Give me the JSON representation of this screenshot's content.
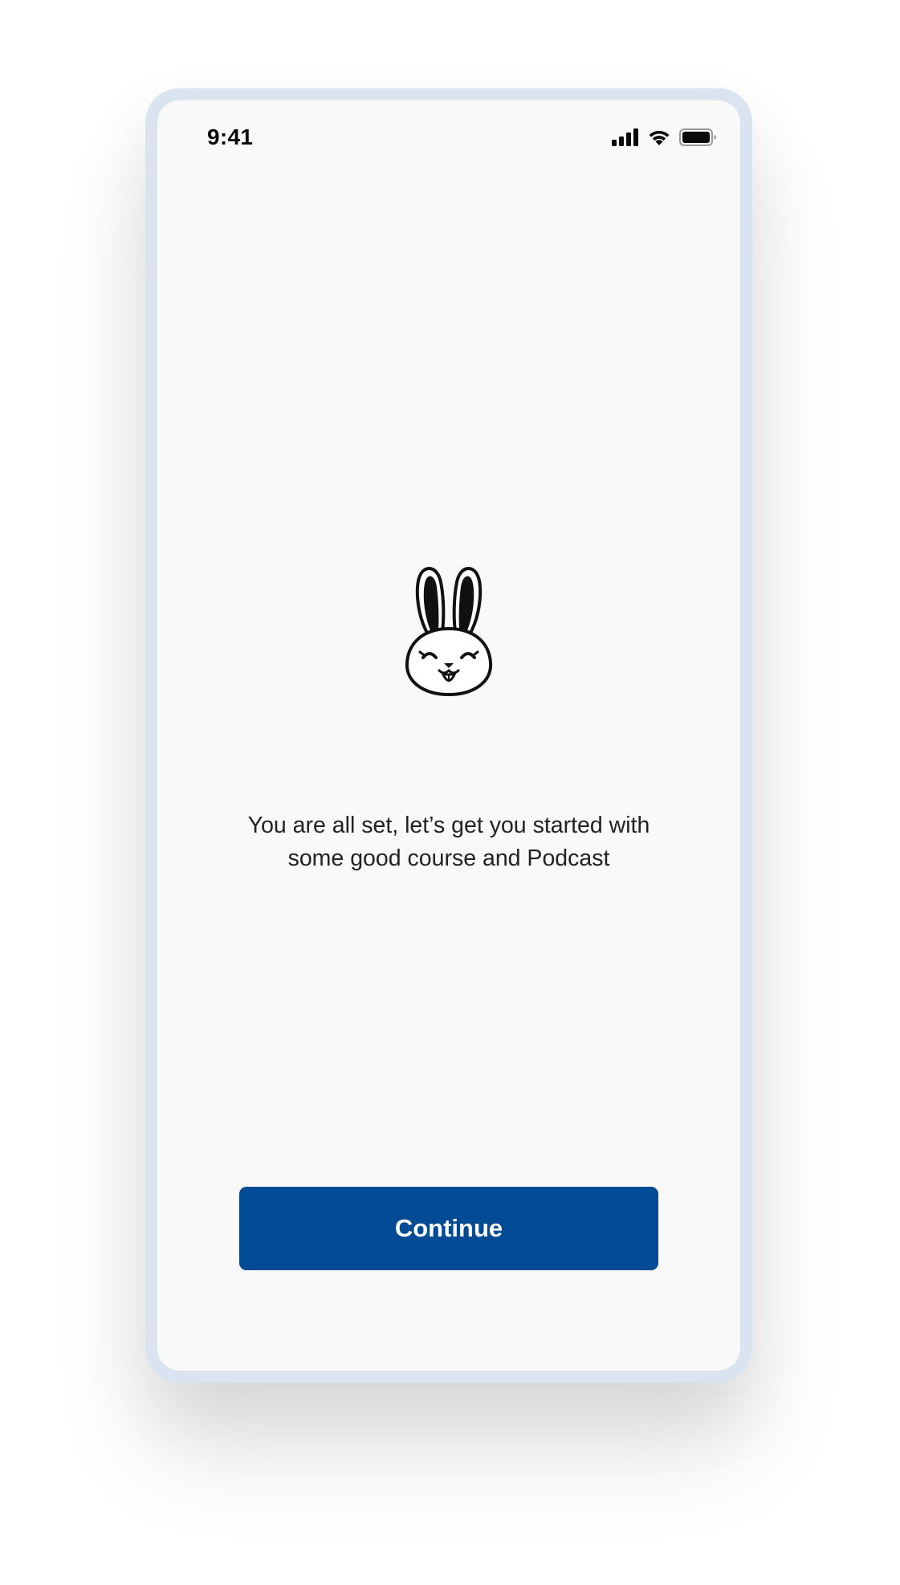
{
  "status_bar": {
    "time": "9:41",
    "icons": [
      "cellular-signal-icon",
      "wifi-icon",
      "battery-icon"
    ]
  },
  "mascot": {
    "icon": "rabbit-icon"
  },
  "message": {
    "line1": "You are all set, let’s get you started with",
    "line2": "some good course and Podcast"
  },
  "actions": {
    "continue_label": "Continue"
  },
  "colors": {
    "accent": "#004b94",
    "frame": "#d9e4f0",
    "screen_background": "#f9f9f9",
    "text": "#222222"
  }
}
